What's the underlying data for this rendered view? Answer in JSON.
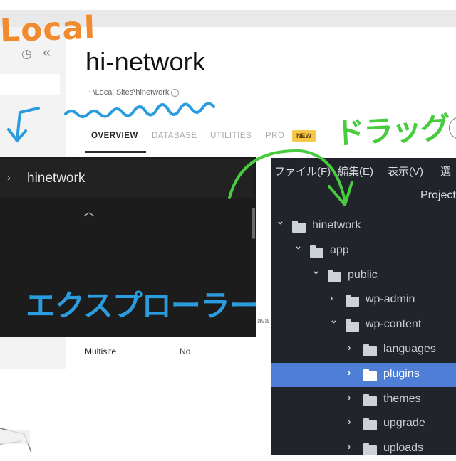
{
  "local_app": {
    "site_title": "hi-network",
    "site_path": "~\\Local Sites\\hinetwork",
    "history_icon": "clock-icon",
    "collapse_icon": "double-chevron-left-icon",
    "tabs": [
      {
        "label": "OVERVIEW",
        "active": true
      },
      {
        "label": "DATABASE",
        "active": false
      },
      {
        "label": "UTILITIES",
        "active": false
      },
      {
        "label": "PRO",
        "active": false
      }
    ],
    "badge": "NEW",
    "badge_color": "#f6c84a",
    "details": [
      {
        "label": "Multisite",
        "value": "No"
      }
    ],
    "partial_text": "ava"
  },
  "explorer": {
    "title": "hinetwork",
    "chevron_icon": "chevron-right-icon",
    "up_icon": "chevron-up-icon"
  },
  "editor": {
    "menu": [
      "ファイル(F)",
      "編集(E)",
      "表示(V)",
      "選"
    ],
    "project_label": "Project",
    "tree": [
      {
        "label": "hinetwork",
        "arrow": "⌄",
        "selected": false
      },
      {
        "label": "app",
        "arrow": "⌄",
        "selected": false
      },
      {
        "label": "public",
        "arrow": "⌄",
        "selected": false
      },
      {
        "label": "wp-admin",
        "arrow": "›",
        "selected": false
      },
      {
        "label": "wp-content",
        "arrow": "⌄",
        "selected": false
      },
      {
        "label": "languages",
        "arrow": "›",
        "selected": false
      },
      {
        "label": "plugins",
        "arrow": "›",
        "selected": true
      },
      {
        "label": "themes",
        "arrow": "›",
        "selected": false
      },
      {
        "label": "upgrade",
        "arrow": "›",
        "selected": false
      },
      {
        "label": "uploads",
        "arrow": "›",
        "selected": false
      }
    ],
    "selection_color": "#4e7ed6"
  },
  "annotations": {
    "local": "Local",
    "drag": "ドラッグ",
    "explorer": "エクスプローラー",
    "colors": {
      "local": "#f28a2e",
      "drag": "#47cc3e",
      "explorer": "#2b9cde"
    }
  }
}
